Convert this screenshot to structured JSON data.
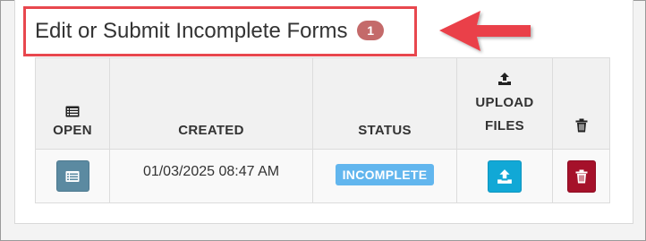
{
  "header": {
    "title": "Edit or Submit Incomplete Forms",
    "count": "1"
  },
  "table": {
    "columns": {
      "open": "OPEN",
      "created": "CREATED",
      "status": "STATUS",
      "upload_line1": "UPLOAD",
      "upload_line2": "FILES"
    },
    "rows": [
      {
        "created": "01/03/2025 08:47 AM",
        "status": "INCOMPLETE"
      }
    ]
  },
  "icons": {
    "open": "list-icon",
    "upload": "upload-icon",
    "delete": "trash-icon",
    "annotation": "red-arrow-icon"
  },
  "colors": {
    "highlight": "#e8474e",
    "badge": "#c46a6a",
    "status": "#62b6ee",
    "open_button": "#5b8aa1",
    "upload_button": "#11a8d6",
    "delete_button": "#a5112a"
  }
}
